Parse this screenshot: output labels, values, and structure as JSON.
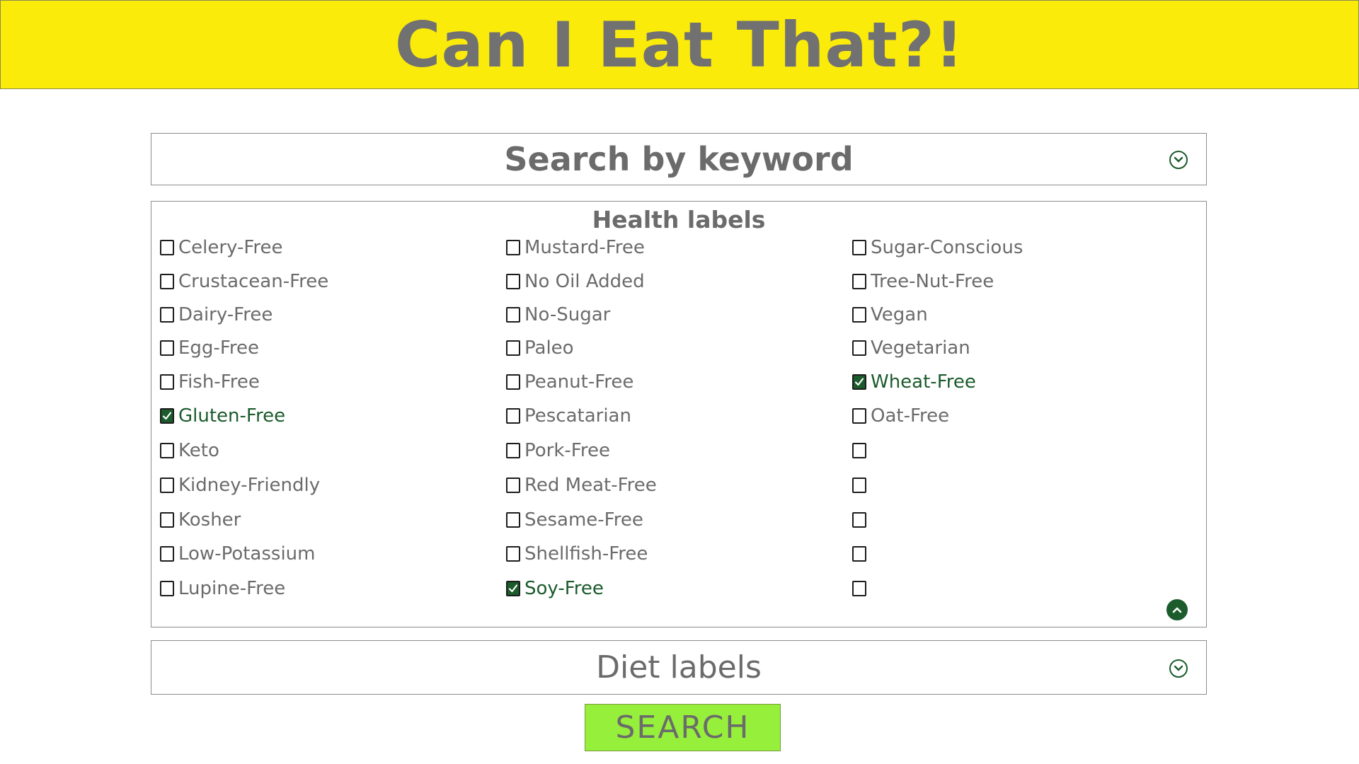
{
  "app": {
    "title": "Can I Eat That?!"
  },
  "keyword": {
    "label": "Search by keyword"
  },
  "health": {
    "title": "Health labels",
    "columns": [
      [
        {
          "label": "Celery-Free",
          "checked": false
        },
        {
          "label": "Crustacean-Free",
          "checked": false
        },
        {
          "label": "Dairy-Free",
          "checked": false
        },
        {
          "label": "Egg-Free",
          "checked": false
        },
        {
          "label": "Fish-Free",
          "checked": false
        },
        {
          "label": "Gluten-Free",
          "checked": true
        },
        {
          "label": "Keto",
          "checked": false
        },
        {
          "label": "Kidney-Friendly",
          "checked": false
        },
        {
          "label": "Kosher",
          "checked": false
        },
        {
          "label": "Low-Potassium",
          "checked": false
        },
        {
          "label": "Lupine-Free",
          "checked": false
        }
      ],
      [
        {
          "label": "Mustard-Free",
          "checked": false
        },
        {
          "label": "No Oil Added",
          "checked": false
        },
        {
          "label": "No-Sugar",
          "checked": false
        },
        {
          "label": "Paleo",
          "checked": false
        },
        {
          "label": "Peanut-Free",
          "checked": false
        },
        {
          "label": "Pescatarian",
          "checked": false
        },
        {
          "label": "Pork-Free",
          "checked": false
        },
        {
          "label": "Red Meat-Free",
          "checked": false
        },
        {
          "label": "Sesame-Free",
          "checked": false
        },
        {
          "label": "Shellfish-Free",
          "checked": false
        },
        {
          "label": "Soy-Free",
          "checked": true
        }
      ],
      [
        {
          "label": "Sugar-Conscious",
          "checked": false
        },
        {
          "label": "Tree-Nut-Free",
          "checked": false
        },
        {
          "label": "Vegan",
          "checked": false
        },
        {
          "label": "Vegetarian",
          "checked": false
        },
        {
          "label": "Wheat-Free",
          "checked": true
        },
        {
          "label": "Oat-Free",
          "checked": false
        },
        {
          "label": "",
          "checked": false
        },
        {
          "label": "",
          "checked": false
        },
        {
          "label": "",
          "checked": false
        },
        {
          "label": "",
          "checked": false
        },
        {
          "label": "",
          "checked": false
        }
      ]
    ]
  },
  "diet": {
    "label": "Diet labels"
  },
  "search": {
    "label": "SEARCH"
  },
  "icons": {
    "expand": "chevron-down-circle-icon",
    "collapse": "chevron-up-circle-icon",
    "check": "checkmark-icon"
  },
  "colors": {
    "header_bg": "#fbeb0b",
    "accent_green": "#1b5b2c",
    "search_bg": "#96ef3b",
    "text_gray": "#6b6b6b"
  }
}
